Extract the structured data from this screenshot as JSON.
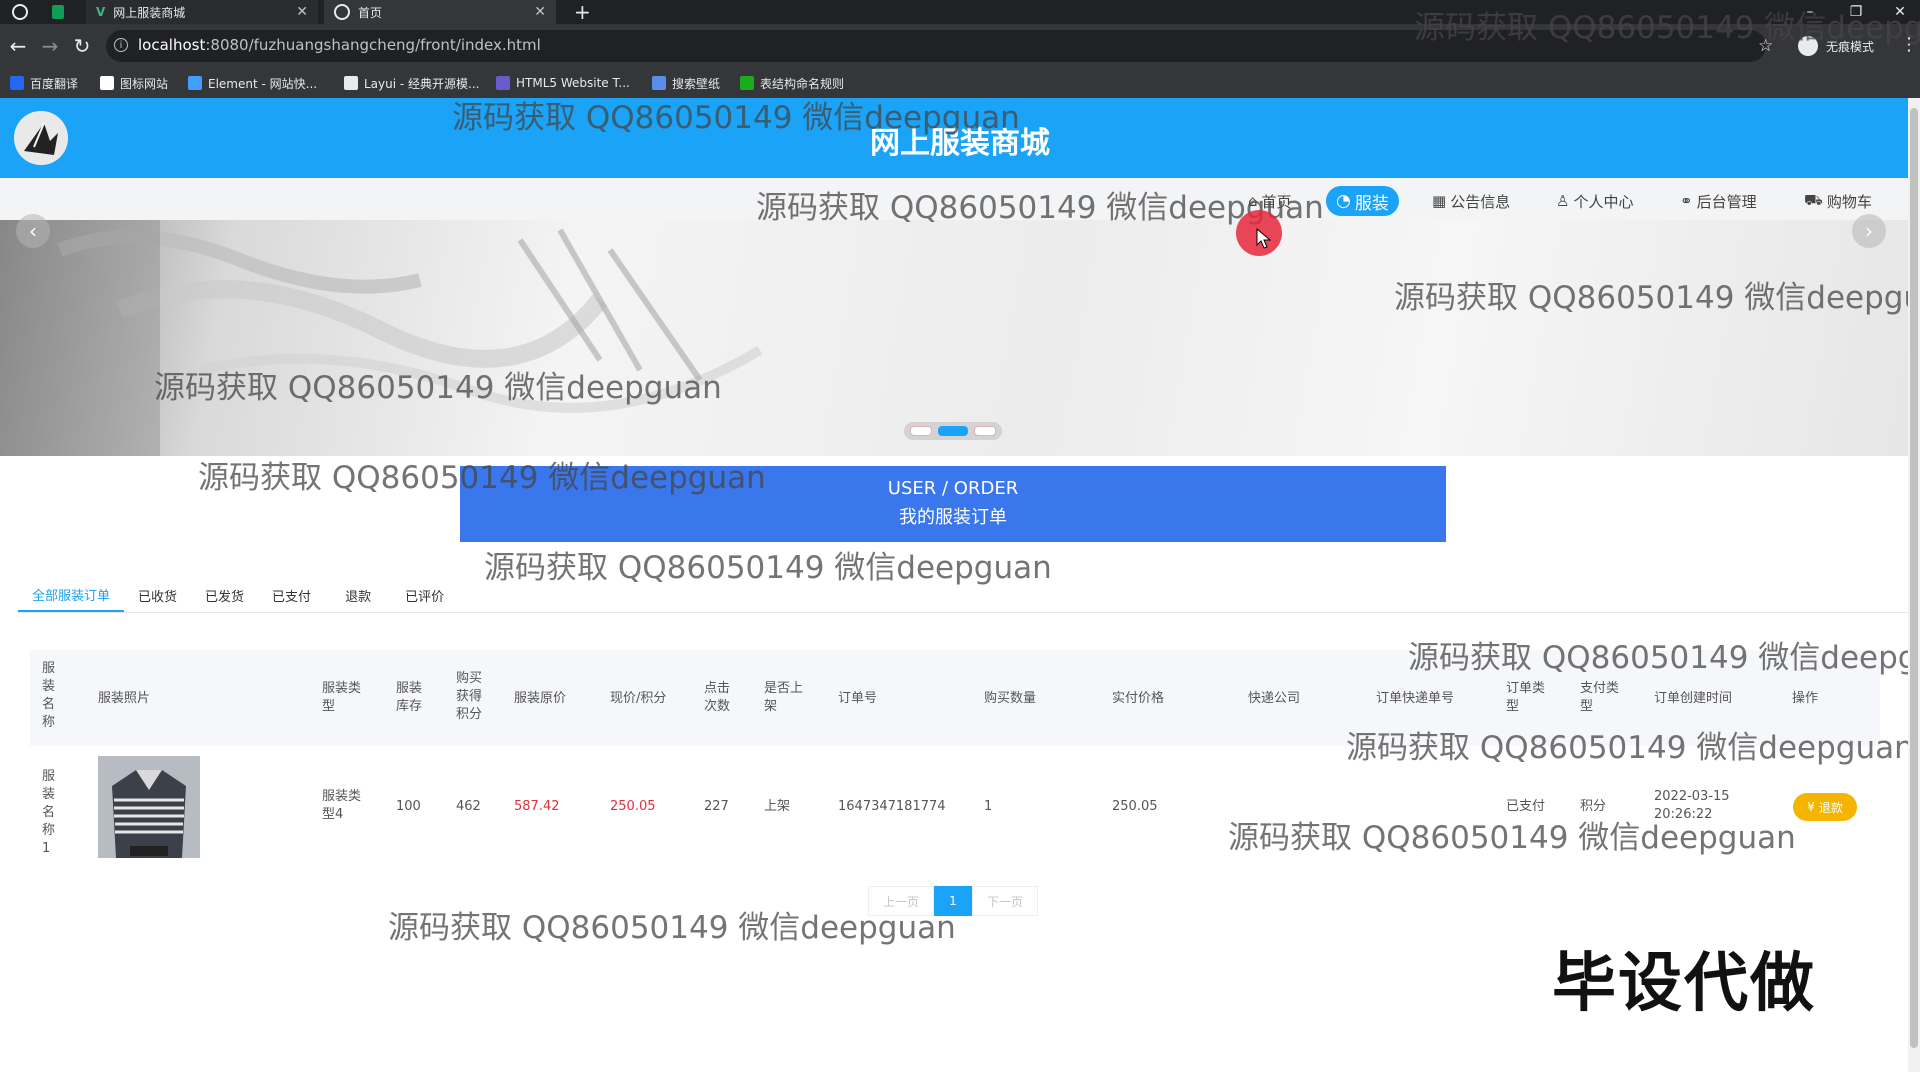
{
  "browser": {
    "tabs": [
      {
        "title": "网上服装商城"
      },
      {
        "title": "首页"
      }
    ],
    "url_host": "localhost",
    "url_path": ":8080/fuzhuangshangcheng/front/index.html",
    "profile_label": "无痕模式",
    "bookmarks": [
      {
        "label": "百度翻译",
        "color": "#2468f2"
      },
      {
        "label": "图标网站",
        "color": "#ffffff"
      },
      {
        "label": "Element - 网站快...",
        "color": "#409eff"
      },
      {
        "label": "Layui - 经典开源模...",
        "color": "#e8eaed"
      },
      {
        "label": "HTML5 Website T...",
        "color": "#6a5acd"
      },
      {
        "label": "搜索壁纸",
        "color": "#5b8def"
      },
      {
        "label": "表结构命名规则",
        "color": "#1aad19"
      }
    ]
  },
  "site": {
    "title": "网上服装商城",
    "brand_color": "#1aa3f7"
  },
  "nav": {
    "items": [
      {
        "label": "首页",
        "icon": "home-icon"
      },
      {
        "label": "服装",
        "icon": "clothes-icon",
        "active": true
      },
      {
        "label": "公告信息",
        "icon": "notice-icon"
      },
      {
        "label": "个人中心",
        "icon": "user-icon"
      },
      {
        "label": "后台管理",
        "icon": "link-icon"
      },
      {
        "label": "购物车",
        "icon": "cart-icon"
      }
    ]
  },
  "carousel": {
    "slides": 3,
    "active_slide": 2
  },
  "banner": {
    "en": "USER / ORDER",
    "cn": "我的服装订单",
    "color": "#3a77ec"
  },
  "order_tabs": [
    {
      "label": "全部服装订单",
      "active": true
    },
    {
      "label": "已收货"
    },
    {
      "label": "已发货"
    },
    {
      "label": "已支付"
    },
    {
      "label": "退款"
    },
    {
      "label": "已评价"
    }
  ],
  "table": {
    "headers": [
      "服装名称",
      "服装照片",
      "服装类型",
      "服装库存",
      "购买获得积分",
      "服装原价",
      "现价/积分",
      "点击次数",
      "是否上架",
      "订单号",
      "购买数量",
      "实付价格",
      "快递公司",
      "订单快递单号",
      "订单类型",
      "支付类型",
      "订单创建时间",
      "操作"
    ],
    "rows": [
      {
        "name": "服装名称1",
        "type": "服装类型4",
        "stock": "100",
        "points": "462",
        "original_price": "587.42",
        "price": "250.05",
        "clicks": "227",
        "shelf": "上架",
        "order_no": "1647347181774",
        "qty": "1",
        "paid": "250.05",
        "courier": "",
        "tracking": "",
        "order_type": "已支付",
        "pay_type": "积分",
        "created_date": "2022-03-15",
        "created_time": "20:26:22",
        "action": "退款"
      }
    ]
  },
  "pagination": {
    "prev": "上一页",
    "page": "1",
    "next": "下一页"
  },
  "watermark": "源码获取 QQ86050149 微信deepguan",
  "stamp": "毕设代做"
}
